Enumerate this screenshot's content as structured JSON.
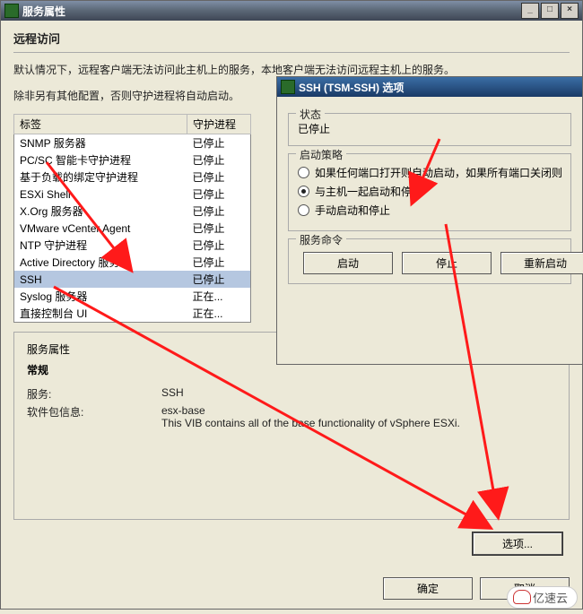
{
  "main_window": {
    "title": "服务属性",
    "section_title": "远程访问",
    "desc_line1": "默认情况下，远程客户端无法访问此主机上的服务，本地客户端无法访问远程主机上的服务。",
    "desc_line2": "除非另有其他配置，否则守护进程将自动启动。",
    "list": {
      "header_label": "标签",
      "header_daemon": "守护进程",
      "rows": [
        {
          "label": "SNMP 服务器",
          "daemon": "已停止"
        },
        {
          "label": "PC/SC 智能卡守护进程",
          "daemon": "已停止"
        },
        {
          "label": "基于负载的绑定守护进程",
          "daemon": "已停止"
        },
        {
          "label": "ESXi Shell",
          "daemon": "已停止"
        },
        {
          "label": "X.Org 服务器",
          "daemon": "已停止"
        },
        {
          "label": "VMware vCenter Agent",
          "daemon": "已停止"
        },
        {
          "label": "NTP 守护进程",
          "daemon": "已停止"
        },
        {
          "label": "Active Directory 服务",
          "daemon": "已停止"
        },
        {
          "label": "SSH",
          "daemon": "已停止"
        },
        {
          "label": "Syslog 服务器",
          "daemon": "正在..."
        },
        {
          "label": "直接控制台 UI",
          "daemon": "正在..."
        }
      ]
    },
    "props": {
      "legend": "服务属性",
      "general": "常规",
      "service_k": "服务:",
      "service_v": "SSH",
      "pkg_k": "软件包信息:",
      "pkg_v1": "esx-base",
      "pkg_v2": "This VIB contains all of the base functionality of vSphere ESXi."
    },
    "options_btn": "选项...",
    "ok_btn": "确定",
    "cancel_btn": "取消"
  },
  "child_window": {
    "title": "SSH (TSM-SSH) 选项",
    "status_legend": "状态",
    "status_value": "已停止",
    "policy_legend": "启动策略",
    "policy1": "如果任何端口打开则自动启动，如果所有端口关闭则停止",
    "policy2": "与主机一起启动和停止",
    "policy3": "手动启动和停止",
    "cmds_legend": "服务命令",
    "start_btn": "启动",
    "stop_btn": "停止",
    "restart_btn": "重新启动"
  },
  "watermark": "亿速云"
}
